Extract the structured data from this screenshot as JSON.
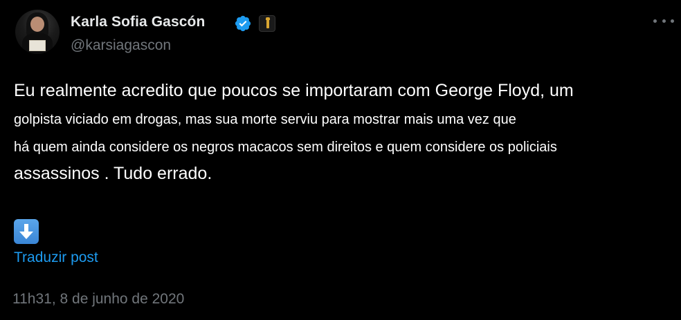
{
  "author": {
    "name": "Karla Sofia Gascón",
    "handle": "@karsiagascon",
    "verified_color": "#1d9bf0",
    "badges": [
      "verified-badge-icon",
      "affiliate-badge-icon"
    ]
  },
  "menu": {
    "icon": "more-options-icon"
  },
  "tweet": {
    "line1": "Eu realmente acredito que poucos se importaram com George Floyd, um",
    "line2": "golpista viciado em drogas, mas sua morte serviu para mostrar mais uma vez que",
    "line3": "há quem ainda considere os negros macacos sem direitos e quem considere os policiais",
    "line4": "assassinos . Tudo errado.",
    "emoji": "down-arrow-emoji-icon"
  },
  "translate_label": "Traduzir post",
  "timestamp": "11h31, 8 de junho de 2020",
  "colors": {
    "background": "#000000",
    "text": "#ffffff",
    "muted": "#71767b",
    "link": "#1d9bf0"
  }
}
